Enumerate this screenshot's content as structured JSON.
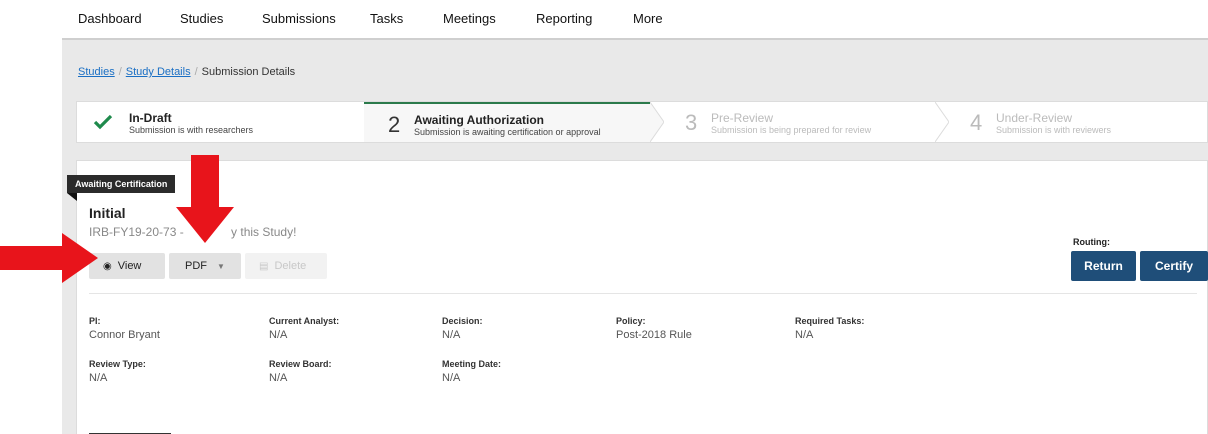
{
  "nav": {
    "items": [
      "Dashboard",
      "Studies",
      "Submissions",
      "Tasks",
      "Meetings",
      "Reporting",
      "More"
    ]
  },
  "breadcrumb": {
    "studies": "Studies",
    "study_details": "Study Details",
    "current": "Submission Details",
    "separator": "/"
  },
  "stepper": {
    "steps": [
      {
        "num": "",
        "title": "In-Draft",
        "sub": "Submission is with researchers",
        "state": "complete"
      },
      {
        "num": "2",
        "title": "Awaiting Authorization",
        "sub": "Submission is awaiting certification or approval",
        "state": "active"
      },
      {
        "num": "3",
        "title": "Pre-Review",
        "sub": "Submission is being prepared for review",
        "state": "pending"
      },
      {
        "num": "4",
        "title": "Under-Review",
        "sub": "Submission is with reviewers",
        "state": "pending"
      }
    ]
  },
  "submission": {
    "status_tag": "Awaiting Certification",
    "title": "Initial",
    "id_prefix": "IRB-FY19-20-73 - ",
    "study_name_tail": "y this Study!"
  },
  "actions": {
    "view": "View",
    "pdf": "PDF",
    "delete": "Delete"
  },
  "routing": {
    "label": "Routing:",
    "return": "Return",
    "certify": "Certify"
  },
  "details": {
    "pi": {
      "label": "PI:",
      "value": "Connor Bryant"
    },
    "current_analyst": {
      "label": "Current Analyst:",
      "value": "N/A"
    },
    "decision": {
      "label": "Decision:",
      "value": "N/A"
    },
    "policy": {
      "label": "Policy:",
      "value": "Post-2018 Rule"
    },
    "required_tasks": {
      "label": "Required Tasks:",
      "value": "N/A"
    },
    "review_type": {
      "label": "Review Type:",
      "value": "N/A"
    },
    "review_board": {
      "label": "Review Board:",
      "value": "N/A"
    },
    "meeting_date": {
      "label": "Meeting Date:",
      "value": "N/A"
    }
  },
  "colors": {
    "primary_button": "#1f4e79",
    "success_check": "#1e8a4c",
    "annotation_arrow": "#e8141b"
  },
  "icons": {
    "step1": "checkmark-icon",
    "view": "eye-icon",
    "delete": "trash-icon",
    "pdf_caret": "caret-down-icon"
  }
}
